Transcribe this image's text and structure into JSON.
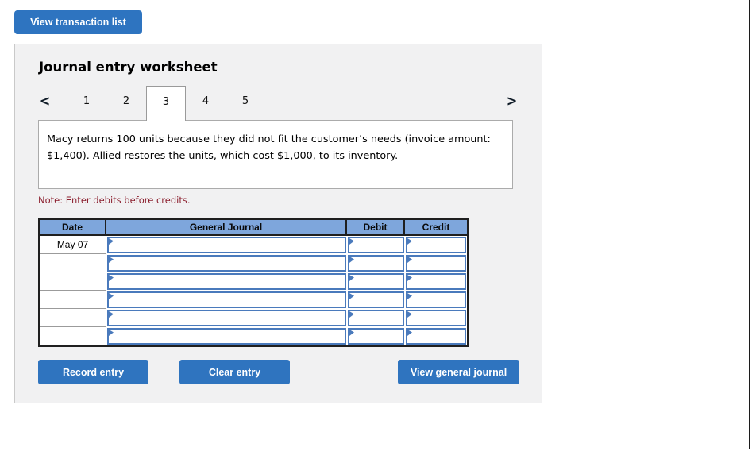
{
  "page": {
    "view_transaction_list_label": "View transaction list"
  },
  "worksheet": {
    "title": "Journal entry worksheet",
    "tabs": {
      "prev_icon": "<",
      "next_icon": ">",
      "items": [
        {
          "label": "1"
        },
        {
          "label": "2"
        },
        {
          "label": "3"
        },
        {
          "label": "4"
        },
        {
          "label": "5"
        }
      ],
      "active_tab": "3"
    },
    "description": "Macy returns 100 units because they did not fit the customer’s needs (invoice amount: $1,400). Allied restores the units, which cost $1,000, to its inventory.",
    "note": "Note: Enter debits before credits.",
    "table": {
      "headers": [
        "Date",
        "General Journal",
        "Debit",
        "Credit"
      ],
      "rows": [
        {
          "date": "May 07",
          "general_journal": "",
          "debit": "",
          "credit": ""
        },
        {
          "date": "",
          "general_journal": "",
          "debit": "",
          "credit": ""
        },
        {
          "date": "",
          "general_journal": "",
          "debit": "",
          "credit": ""
        },
        {
          "date": "",
          "general_journal": "",
          "debit": "",
          "credit": ""
        },
        {
          "date": "",
          "general_journal": "",
          "debit": "",
          "credit": ""
        },
        {
          "date": "",
          "general_journal": "",
          "debit": "",
          "credit": ""
        }
      ]
    },
    "buttons": {
      "record_entry": "Record entry",
      "clear_entry": "Clear entry",
      "view_general_journal": "View general journal"
    }
  },
  "colors": {
    "button_blue": "#2f74bf",
    "table_header_blue": "#7ea6dc",
    "cell_border_blue": "#4a7abc",
    "note_red": "#8b1e2d",
    "panel_bg": "#f1f1f2"
  }
}
